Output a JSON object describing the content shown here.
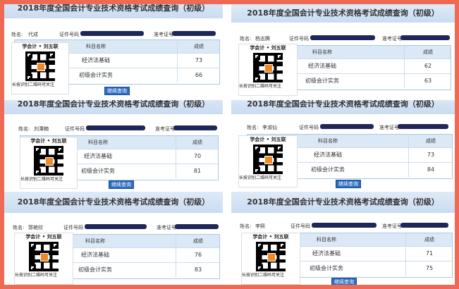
{
  "panels": [
    {
      "title": "2018年度全国会计专业技术资格考试成绩查询（初级）",
      "name_label": "姓名:",
      "name_value": "代成",
      "id_label": "证件号码",
      "ticket_label": "准考证号",
      "col_subject": "科目名称",
      "col_score": "成绩",
      "rows": [
        {
          "subject": "经济法基础",
          "score": "73"
        },
        {
          "subject": "初级会计实务",
          "score": "66"
        }
      ],
      "button": "继续查询"
    },
    {
      "title": "2018年度全国会计专业技术资格考试成绩查询（初级）",
      "name_label": "姓名:",
      "name_value": "杨志腾",
      "id_label": "证件号码",
      "ticket_label": "准考证号",
      "col_subject": "科目名称",
      "col_score": "成绩",
      "rows": [
        {
          "subject": "经济法基础",
          "score": "62"
        },
        {
          "subject": "初级会计实务",
          "score": "63"
        }
      ],
      "button": ""
    },
    {
      "title": "2018年度全国会计专业技术资格考试成绩查询（初级）",
      "name_label": "姓名:",
      "name_value": "刘潭楠",
      "id_label": "证件号码",
      "ticket_label": "准考证号",
      "col_subject": "科目名称",
      "col_score": "成绩",
      "rows": [
        {
          "subject": "经济法基础",
          "score": "70"
        },
        {
          "subject": "初级会计实务",
          "score": "81"
        }
      ],
      "button": "继续查询"
    },
    {
      "title": "2018年度全国会计专业技术资格考试成绩查询（初级）",
      "name_label": "姓名:",
      "name_value": "李淑仙",
      "id_label": "证件号码",
      "ticket_label": "准考证号",
      "col_subject": "科目名称",
      "col_score": "成绩",
      "rows": [
        {
          "subject": "经济法基础",
          "score": "73"
        },
        {
          "subject": "初级会计实务",
          "score": "84"
        }
      ],
      "button": "继续查询"
    },
    {
      "title": "2018年度全国会计专业技术资格考试成绩查询（初级）",
      "name_label": "姓名:",
      "name_value": "郭艳欣",
      "id_label": "证件号码",
      "ticket_label": "准考证号",
      "col_subject": "科目名称",
      "col_score": "成绩",
      "rows": [
        {
          "subject": "经济法基础",
          "score": "76"
        },
        {
          "subject": "初级会计实务",
          "score": "83"
        }
      ],
      "button": ""
    },
    {
      "title": "2018年度全国会计专业技术资格考试成绩查询（初级）",
      "name_label": "姓名:",
      "name_value": "李熙",
      "id_label": "证件号码",
      "ticket_label": "准考证号",
      "col_subject": "科目名称",
      "col_score": "成绩",
      "rows": [
        {
          "subject": "经济法基础",
          "score": "71"
        },
        {
          "subject": "初级会计实务",
          "score": "75"
        }
      ],
      "button": "继续查询"
    }
  ],
  "watermark": {
    "title": "学会计 • 刘五联",
    "caption": "长按识别二维码可关注",
    "icon": "qr-code-icon"
  }
}
